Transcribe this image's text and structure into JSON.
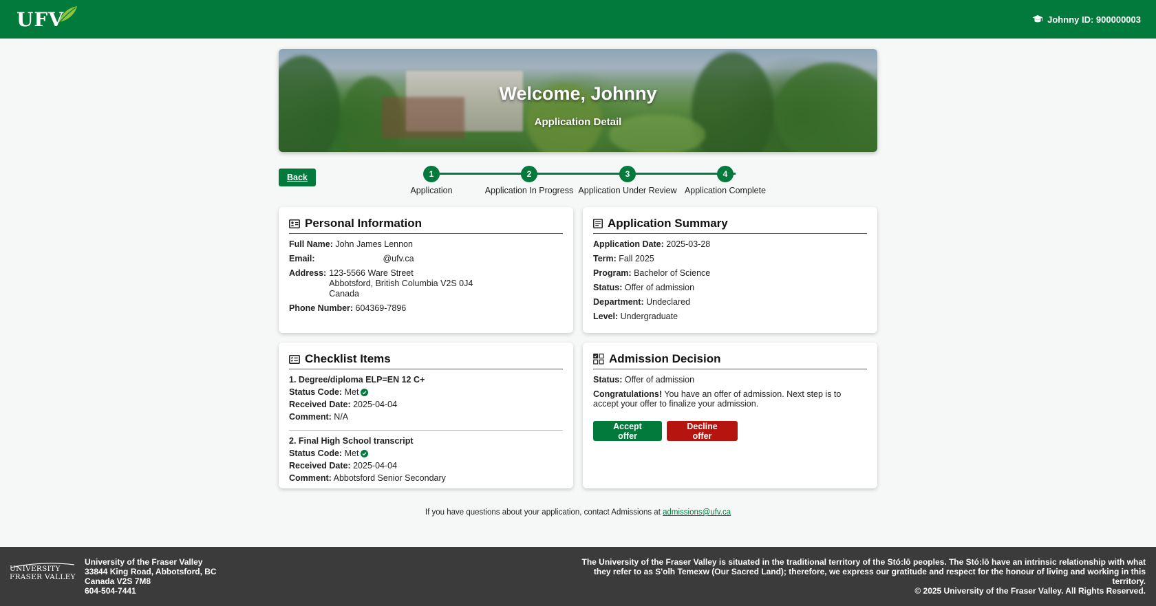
{
  "header": {
    "logo_text": "UFV",
    "user_label": "Johnny ID: 900000003"
  },
  "hero": {
    "title": "Welcome, Johnny",
    "subtitle": "Application Detail"
  },
  "back_label": "Back",
  "steps": [
    {
      "num": "1",
      "label": "Application"
    },
    {
      "num": "2",
      "label": "Application In Progress"
    },
    {
      "num": "3",
      "label": "Application Under Review"
    },
    {
      "num": "4",
      "label": "Application Complete"
    }
  ],
  "personal": {
    "title": "Personal Information",
    "full_name_label": "Full Name:",
    "full_name": "John James Lennon",
    "email_label": "Email:",
    "email": "@ufv.ca",
    "address_label": "Address:",
    "address_line1": "123-5566 Ware Street",
    "address_line2": "Abbotsford, British Columbia V2S 0J4",
    "address_line3": "Canada",
    "phone_label": "Phone Number:",
    "phone": "604369-7896"
  },
  "summary": {
    "title": "Application Summary",
    "app_date_label": "Application Date:",
    "app_date": "2025-03-28",
    "term_label": "Term:",
    "term": "Fall 2025",
    "program_label": "Program:",
    "program": "Bachelor of Science",
    "status_label": "Status:",
    "status": "Offer of admission",
    "department_label": "Department:",
    "department": "Undeclared",
    "level_label": "Level:",
    "level": "Undergraduate"
  },
  "checklist": {
    "title": "Checklist Items",
    "status_code_label": "Status Code:",
    "received_label": "Received Date:",
    "comment_label": "Comment:",
    "items": [
      {
        "title": "1. Degree/diploma ELP=EN 12 C+",
        "status": "Met",
        "received": "2025-04-04",
        "comment": "N/A"
      },
      {
        "title": "2. Final High School transcript",
        "status": "Met",
        "received": "2025-04-04",
        "comment": "Abbotsford Senior Secondary"
      }
    ]
  },
  "decision": {
    "title": "Admission Decision",
    "status_label": "Status:",
    "status": "Offer of admission",
    "congrats": "Congratulations!",
    "message": "You have an offer of admission. Next step is to accept your offer to finalize your admission.",
    "accept_label": "Accept offer",
    "decline_label": "Decline offer"
  },
  "contact": {
    "text": "If you have questions about your application, contact Admissions at",
    "email": "admissions@ufv.ca"
  },
  "footer": {
    "logo_line1": "UNIVERSITY",
    "logo_line2": "FRASER VALLEY",
    "addr_name": "University of the Fraser Valley",
    "addr_line1": "33844 King Road, Abbotsford, BC",
    "addr_line2": "Canada V2S 7M8",
    "addr_phone": "604-504-7441",
    "acknowledgement": "The University of the Fraser Valley is situated in the traditional territory of the Stó:lō peoples. The Stó:lō have an intrinsic relationship with what they refer to as S'olh Temexw (Our Sacred Land); therefore, we express our gratitude and respect for the honour of living and working in this territory.",
    "copyright": "© 2025 University of the Fraser Valley. All Rights Reserved."
  },
  "colors": {
    "brand_green": "#027a3c",
    "decline_red": "#b5140f",
    "footer_bg": "#3b3b3b"
  }
}
